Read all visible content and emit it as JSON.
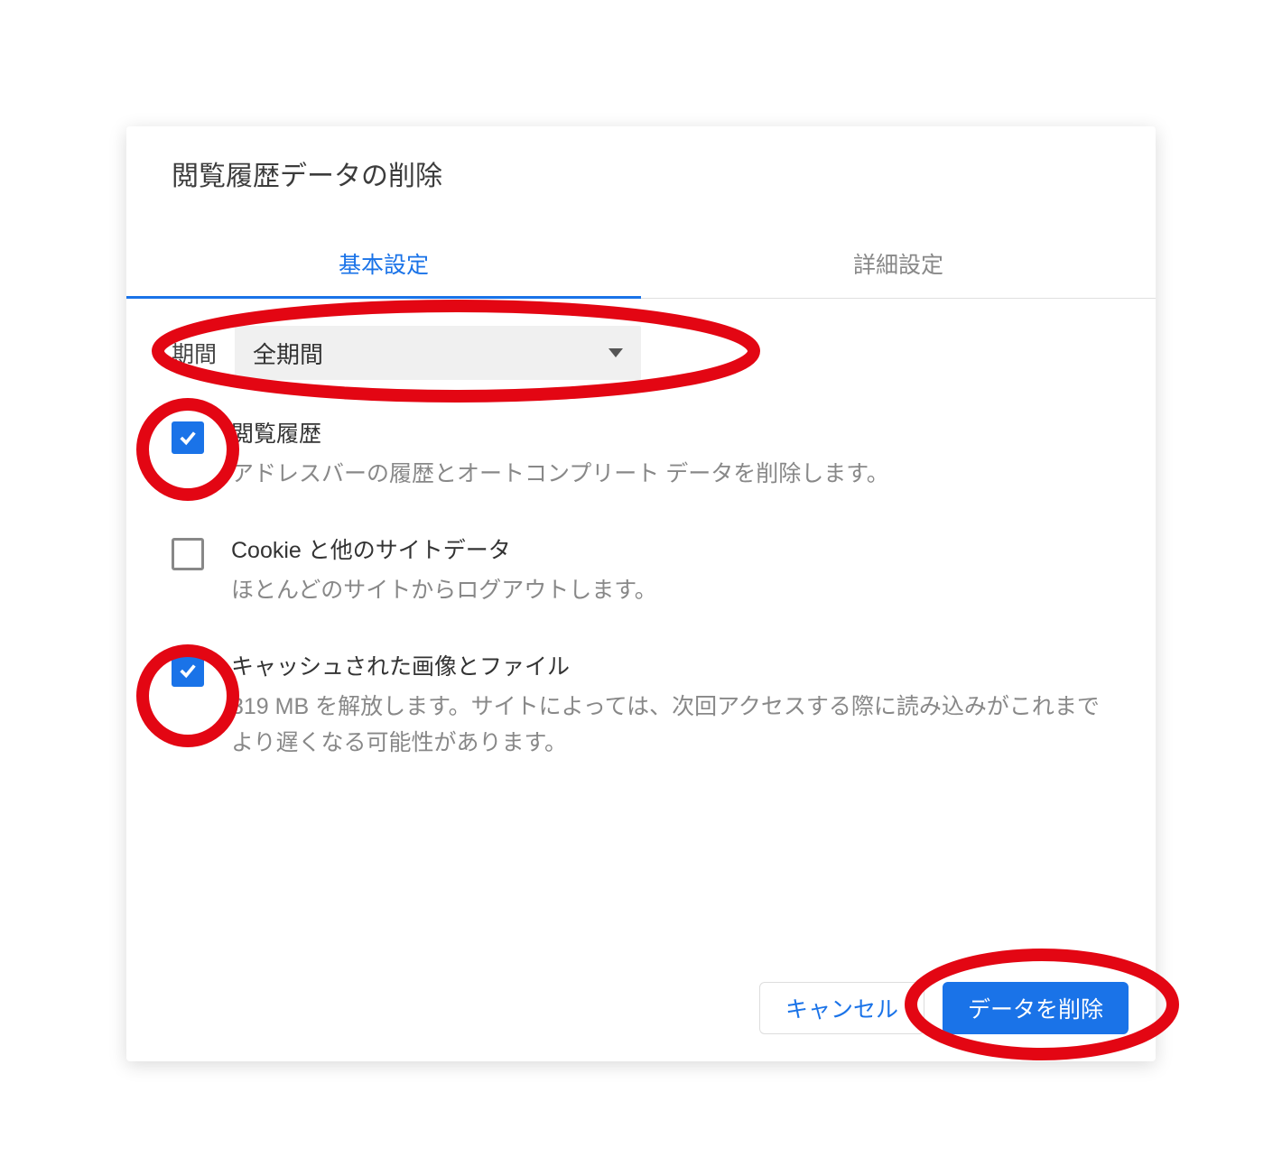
{
  "dialog": {
    "title": "閲覧履歴データの削除",
    "tabs": {
      "basic": "基本設定",
      "advanced": "詳細設定"
    },
    "range": {
      "label": "期間",
      "value": "全期間"
    },
    "options": [
      {
        "checked": true,
        "title": "閲覧履歴",
        "desc": "アドレスバーの履歴とオートコンプリート データを削除します。"
      },
      {
        "checked": false,
        "title": "Cookie と他のサイトデータ",
        "desc": "ほとんどのサイトからログアウトします。"
      },
      {
        "checked": true,
        "title": "キャッシュされた画像とファイル",
        "desc": "319 MB を解放します。サイトによっては、次回アクセスする際に読み込みがこれまでより遅くなる可能性があります。"
      }
    ],
    "buttons": {
      "cancel": "キャンセル",
      "confirm": "データを削除"
    }
  },
  "annotations": {
    "color": "#e30613"
  }
}
